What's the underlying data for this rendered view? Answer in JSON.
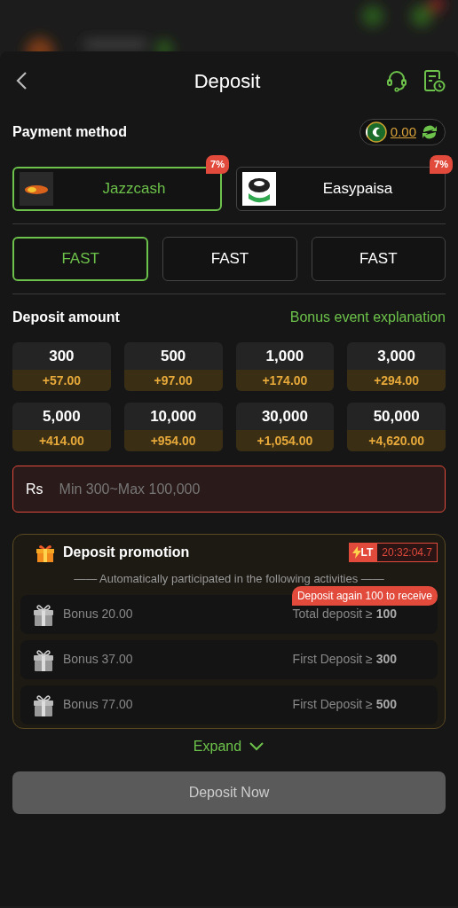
{
  "header": {
    "title": "Deposit"
  },
  "payment": {
    "title": "Payment method",
    "balance": "0.00",
    "methods": [
      {
        "name": "Jazzcash",
        "badge": "7%",
        "selected": true,
        "kind": "jazz"
      },
      {
        "name": "Easypaisa",
        "badge": "7%",
        "selected": false,
        "kind": "easy"
      }
    ],
    "channels": [
      {
        "label": "FAST",
        "selected": true
      },
      {
        "label": "FAST",
        "selected": false
      },
      {
        "label": "FAST",
        "selected": false
      }
    ]
  },
  "amount": {
    "title": "Deposit amount",
    "link": "Bonus event explanation",
    "options": [
      {
        "amount": "300",
        "bonus": "+57.00"
      },
      {
        "amount": "500",
        "bonus": "+97.00"
      },
      {
        "amount": "1,000",
        "bonus": "+174.00"
      },
      {
        "amount": "3,000",
        "bonus": "+294.00"
      },
      {
        "amount": "5,000",
        "bonus": "+414.00"
      },
      {
        "amount": "10,000",
        "bonus": "+954.00"
      },
      {
        "amount": "30,000",
        "bonus": "+1,054.00"
      },
      {
        "amount": "50,000",
        "bonus": "+4,620.00"
      }
    ],
    "currency": "Rs",
    "placeholder": "Min 300~Max 100,000"
  },
  "promotion": {
    "title": "Deposit promotion",
    "tag": "LT",
    "timer": "20:32:04.7",
    "note": "—— Automatically participated in the following activities ——",
    "rows": [
      {
        "bonus": "Bonus 20.00",
        "condition": "Total deposit ≥ **100**",
        "tip": "Deposit again 100 to receive"
      },
      {
        "bonus": "Bonus 37.00",
        "condition": "First Deposit ≥ **300**"
      },
      {
        "bonus": "Bonus 77.00",
        "condition": "First Deposit ≥ **500**"
      }
    ],
    "expand": "Expand"
  },
  "submit": {
    "label": "Deposit Now",
    "disabled": true
  }
}
